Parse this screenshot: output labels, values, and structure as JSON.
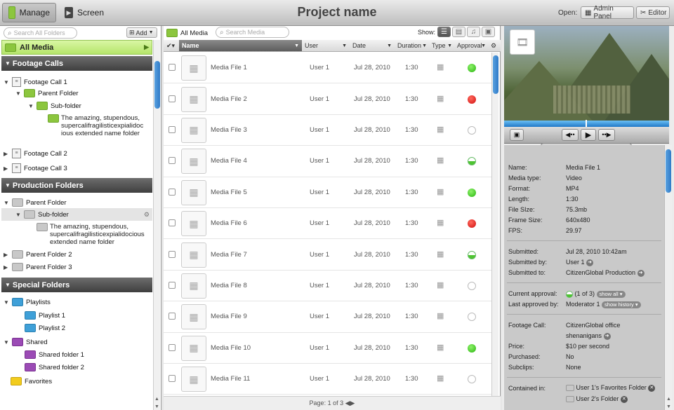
{
  "topbar": {
    "manage_label": "Manage",
    "screen_label": "Screen",
    "project_title": "Project name",
    "open_label": "Open:",
    "admin_panel_label": "Admin Panel",
    "editor_label": "Editor"
  },
  "left": {
    "search_placeholder": "Search All Folders",
    "add_label": "Add",
    "all_media_label": "All Media",
    "footage_header": "Footage Calls",
    "footage_call_1": "Footage Call 1",
    "fc1_parent": "Parent Folder",
    "fc1_sub": "Sub-folder",
    "fc1_long_1": "The amazing, stupendous,",
    "fc1_long_2": "supercalifragilisticexpialidoc",
    "fc1_long_3": "ious extended name folder",
    "footage_call_2": "Footage Call 2",
    "footage_call_3": "Footage Call 3",
    "production_header": "Production Folders",
    "pf_parent": "Parent Folder",
    "pf_sub": "Sub-folder",
    "pf_long_1": "The amazing, stupendous,",
    "pf_long_2": "supercalifragilisticexpialidocious",
    "pf_long_3": "extended name folder",
    "pf_parent2": "Parent Folder 2",
    "pf_parent3": "Parent Folder 3",
    "special_header": "Special Folders",
    "playlists": "Playlists",
    "playlist1": "Playlist 1",
    "playlist2": "Playlist 2",
    "shared": "Shared",
    "shared1": "Shared folder 1",
    "shared2": "Shared folder 2",
    "favorites": "Favorites"
  },
  "middle": {
    "breadcrumb": "All Media",
    "search_placeholder": "Search Media",
    "show_label": "Show:",
    "columns": {
      "name": "Name",
      "user": "User",
      "date": "Date",
      "duration": "Duration",
      "type": "Type",
      "approval": "Approval"
    },
    "rows": [
      {
        "name": "Media File 1",
        "user": "User 1",
        "date": "Jul 28, 2010",
        "duration": "1:30",
        "approval": "green"
      },
      {
        "name": "Media File 2",
        "user": "User 1",
        "date": "Jul 28, 2010",
        "duration": "1:30",
        "approval": "red"
      },
      {
        "name": "Media File 3",
        "user": "User 1",
        "date": "Jul 28, 2010",
        "duration": "1:30",
        "approval": "empty"
      },
      {
        "name": "Media File 4",
        "user": "User 1",
        "date": "Jul 28, 2010",
        "duration": "1:30",
        "approval": "half"
      },
      {
        "name": "Media File 5",
        "user": "User 1",
        "date": "Jul 28, 2010",
        "duration": "1:30",
        "approval": "green"
      },
      {
        "name": "Media File 6",
        "user": "User 1",
        "date": "Jul 28, 2010",
        "duration": "1:30",
        "approval": "red"
      },
      {
        "name": "Media File 7",
        "user": "User 1",
        "date": "Jul 28, 2010",
        "duration": "1:30",
        "approval": "half"
      },
      {
        "name": "Media File 8",
        "user": "User 1",
        "date": "Jul 28, 2010",
        "duration": "1:30",
        "approval": "empty"
      },
      {
        "name": "Media File 9",
        "user": "User 1",
        "date": "Jul 28, 2010",
        "duration": "1:30",
        "approval": "empty"
      },
      {
        "name": "Media File 10",
        "user": "User 1",
        "date": "Jul 28, 2010",
        "duration": "1:30",
        "approval": "green"
      },
      {
        "name": "Media File 11",
        "user": "User 1",
        "date": "Jul 28, 2010",
        "duration": "1:30",
        "approval": "empty"
      }
    ],
    "pager": "Page: 1 of 3"
  },
  "right": {
    "name_label": "Name:",
    "name_value": "Media File 1",
    "mtype_label": "Media type:",
    "mtype_value": "Video",
    "format_label": "Format:",
    "format_value": "MP4",
    "length_label": "Length:",
    "length_value": "1:30",
    "fsize_label": "File SIze:",
    "fsize_value": "75.3mb",
    "frame_label": "Frame Size:",
    "frame_value": "640x480",
    "fps_label": "FPS:",
    "fps_value": "29.97",
    "submitted_label": "Submitted:",
    "submitted_value": "Jul 28, 2010  10:42am",
    "subby_label": "Submitted by:",
    "subby_value": "User 1",
    "subto_label": "Submitted to:",
    "subto_value": "CitizenGlobal Production",
    "curappr_label": "Current approval:",
    "curappr_value": "(1 of 3)",
    "show_all": "show all",
    "lastappr_label": "Last approved by:",
    "lastappr_value": "Moderator 1",
    "show_history": "show history",
    "fcall_label": "Footage Call:",
    "fcall_value1": "CitizenGlobal office",
    "fcall_value2": "shenanigans",
    "price_label": "Price:",
    "price_value": "$10 per second",
    "purchased_label": "Purchased:",
    "purchased_value": "No",
    "subclips_label": "Subclips:",
    "subclips_value": "None",
    "contained_label": "Contained in:",
    "contained1": "User 1's Favorites Folder",
    "contained2": "User 2's Folder"
  }
}
